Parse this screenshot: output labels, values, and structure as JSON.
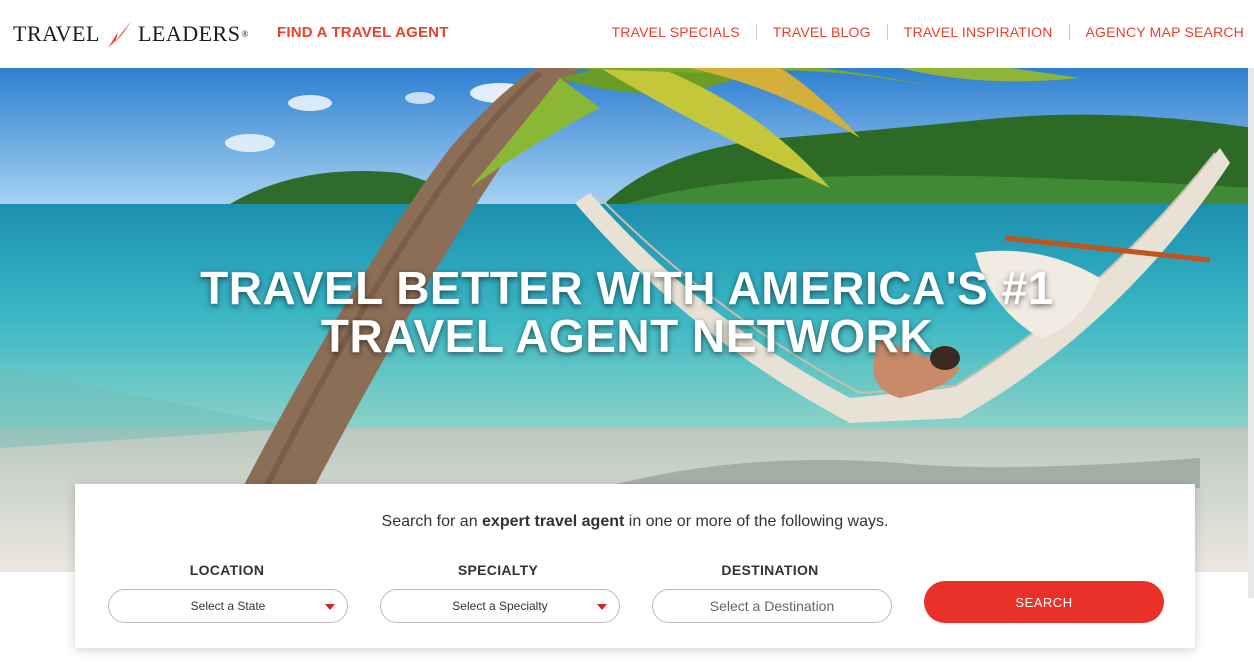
{
  "header": {
    "logo_left": "TRAVEL",
    "logo_right": "LEADERS",
    "logo_reg": "®",
    "find_agent": "FIND A TRAVEL AGENT",
    "nav": [
      "TRAVEL SPECIALS",
      "TRAVEL BLOG",
      "TRAVEL INSPIRATION",
      "AGENCY MAP SEARCH"
    ]
  },
  "hero": {
    "title_line1": "TRAVEL BETTER WITH AMERICA'S #1",
    "title_line2": "TRAVEL AGENT NETWORK"
  },
  "search": {
    "intro_prefix": "Search for an ",
    "intro_bold": "expert travel agent",
    "intro_suffix": " in one or more of the following ways.",
    "location_label": "LOCATION",
    "location_value": "Select a State",
    "specialty_label": "SPECIALTY",
    "specialty_value": "Select a Specialty",
    "destination_label": "DESTINATION",
    "destination_placeholder": "Select a Destination",
    "button": "SEARCH"
  },
  "colors": {
    "brand_red": "#e8412c",
    "button_red": "#e9312a"
  }
}
